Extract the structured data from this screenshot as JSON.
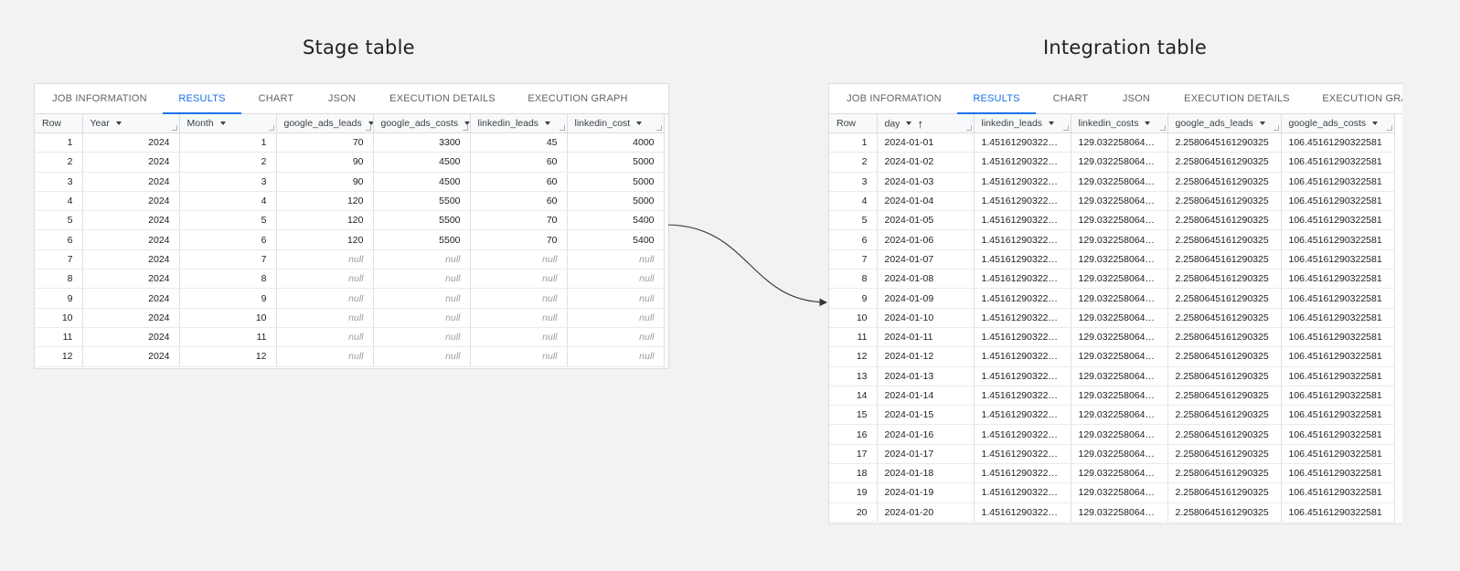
{
  "stage": {
    "title": "Stage table",
    "tabs": [
      "JOB INFORMATION",
      "RESULTS",
      "CHART",
      "JSON",
      "EXECUTION DETAILS",
      "EXECUTION GRAPH"
    ],
    "active_tab": 1,
    "columns": [
      {
        "label": "Row",
        "sort": false
      },
      {
        "label": "Year",
        "sort": true
      },
      {
        "label": "Month",
        "sort": true
      },
      {
        "label": "google_ads_leads",
        "sort": true
      },
      {
        "label": "google_ads_costs",
        "sort": true
      },
      {
        "label": "linkedin_leads",
        "sort": true
      },
      {
        "label": "linkedin_cost",
        "sort": true
      }
    ],
    "rows": [
      [
        "1",
        "2024",
        "1",
        "70",
        "3300",
        "45",
        "4000"
      ],
      [
        "2",
        "2024",
        "2",
        "90",
        "4500",
        "60",
        "5000"
      ],
      [
        "3",
        "2024",
        "3",
        "90",
        "4500",
        "60",
        "5000"
      ],
      [
        "4",
        "2024",
        "4",
        "120",
        "5500",
        "60",
        "5000"
      ],
      [
        "5",
        "2024",
        "5",
        "120",
        "5500",
        "70",
        "5400"
      ],
      [
        "6",
        "2024",
        "6",
        "120",
        "5500",
        "70",
        "5400"
      ],
      [
        "7",
        "2024",
        "7",
        "null",
        "null",
        "null",
        "null"
      ],
      [
        "8",
        "2024",
        "8",
        "null",
        "null",
        "null",
        "null"
      ],
      [
        "9",
        "2024",
        "9",
        "null",
        "null",
        "null",
        "null"
      ],
      [
        "10",
        "2024",
        "10",
        "null",
        "null",
        "null",
        "null"
      ],
      [
        "11",
        "2024",
        "11",
        "null",
        "null",
        "null",
        "null"
      ],
      [
        "12",
        "2024",
        "12",
        "null",
        "null",
        "null",
        "null"
      ]
    ]
  },
  "integration": {
    "title": "Integration table",
    "tabs": [
      "JOB INFORMATION",
      "RESULTS",
      "CHART",
      "JSON",
      "EXECUTION DETAILS",
      "EXECUTION GRAPH"
    ],
    "active_tab": 1,
    "columns": [
      {
        "label": "Row",
        "sort": false
      },
      {
        "label": "day",
        "sort": true,
        "sorted_asc": true
      },
      {
        "label": "linkedin_leads",
        "sort": true
      },
      {
        "label": "linkedin_costs",
        "sort": true
      },
      {
        "label": "google_ads_leads",
        "sort": true
      },
      {
        "label": "google_ads_costs",
        "sort": true
      }
    ],
    "rows": [
      [
        "1",
        "2024-01-01",
        "1.451612903225...",
        "129.0322580645...",
        "2.2580645161290325",
        "106.45161290322581"
      ],
      [
        "2",
        "2024-01-02",
        "1.451612903225...",
        "129.0322580645...",
        "2.2580645161290325",
        "106.45161290322581"
      ],
      [
        "3",
        "2024-01-03",
        "1.451612903225...",
        "129.0322580645...",
        "2.2580645161290325",
        "106.45161290322581"
      ],
      [
        "4",
        "2024-01-04",
        "1.451612903225...",
        "129.0322580645...",
        "2.2580645161290325",
        "106.45161290322581"
      ],
      [
        "5",
        "2024-01-05",
        "1.451612903225...",
        "129.0322580645...",
        "2.2580645161290325",
        "106.45161290322581"
      ],
      [
        "6",
        "2024-01-06",
        "1.451612903225...",
        "129.0322580645...",
        "2.2580645161290325",
        "106.45161290322581"
      ],
      [
        "7",
        "2024-01-07",
        "1.451612903225...",
        "129.0322580645...",
        "2.2580645161290325",
        "106.45161290322581"
      ],
      [
        "8",
        "2024-01-08",
        "1.451612903225...",
        "129.0322580645...",
        "2.2580645161290325",
        "106.45161290322581"
      ],
      [
        "9",
        "2024-01-09",
        "1.451612903225...",
        "129.0322580645...",
        "2.2580645161290325",
        "106.45161290322581"
      ],
      [
        "10",
        "2024-01-10",
        "1.451612903225...",
        "129.0322580645...",
        "2.2580645161290325",
        "106.45161290322581"
      ],
      [
        "11",
        "2024-01-11",
        "1.451612903225...",
        "129.0322580645...",
        "2.2580645161290325",
        "106.45161290322581"
      ],
      [
        "12",
        "2024-01-12",
        "1.451612903225...",
        "129.0322580645...",
        "2.2580645161290325",
        "106.45161290322581"
      ],
      [
        "13",
        "2024-01-13",
        "1.451612903225...",
        "129.0322580645...",
        "2.2580645161290325",
        "106.45161290322581"
      ],
      [
        "14",
        "2024-01-14",
        "1.451612903225...",
        "129.0322580645...",
        "2.2580645161290325",
        "106.45161290322581"
      ],
      [
        "15",
        "2024-01-15",
        "1.451612903225...",
        "129.0322580645...",
        "2.2580645161290325",
        "106.45161290322581"
      ],
      [
        "16",
        "2024-01-16",
        "1.451612903225...",
        "129.0322580645...",
        "2.2580645161290325",
        "106.45161290322581"
      ],
      [
        "17",
        "2024-01-17",
        "1.451612903225...",
        "129.0322580645...",
        "2.2580645161290325",
        "106.45161290322581"
      ],
      [
        "18",
        "2024-01-18",
        "1.451612903225...",
        "129.0322580645...",
        "2.2580645161290325",
        "106.45161290322581"
      ],
      [
        "19",
        "2024-01-19",
        "1.451612903225...",
        "129.0322580645...",
        "2.2580645161290325",
        "106.45161290322581"
      ],
      [
        "20",
        "2024-01-20",
        "1.451612903225...",
        "129.0322580645...",
        "2.2580645161290325",
        "106.45161290322581"
      ]
    ]
  },
  "colors": {
    "accent": "#1a73e8",
    "null_text": "#9aa0a6",
    "background": "#f2f2f2"
  }
}
